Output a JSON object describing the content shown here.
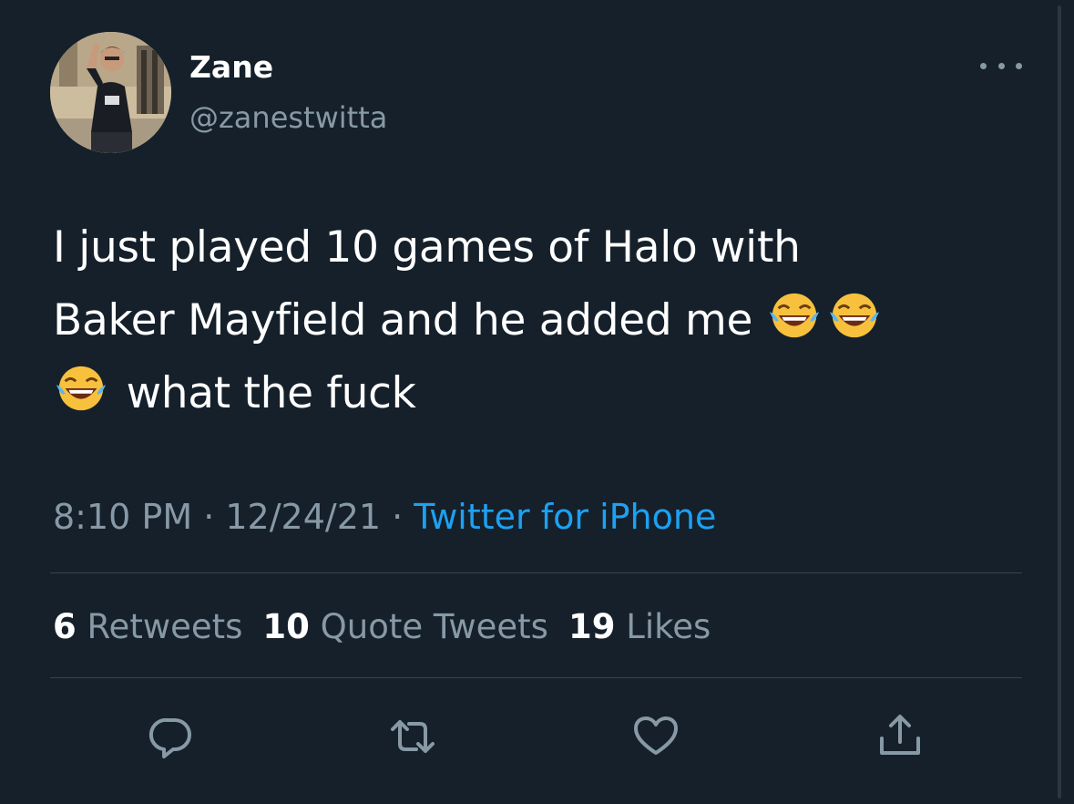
{
  "user": {
    "display_name": "Zane",
    "handle": "@zanestwitta"
  },
  "tweet": {
    "line1": "I just played 10 games of Halo with",
    "line2": "Baker Mayfield and he added me",
    "line3": "what the fuck",
    "emoji_name": "face-with-tears-of-joy"
  },
  "meta": {
    "time": "8:10 PM",
    "sep1": " · ",
    "date": "12/24/21",
    "sep2": " · ",
    "source": "Twitter for iPhone"
  },
  "stats": {
    "retweets_count": "6",
    "retweets_label": "Retweets",
    "quotes_count": "10",
    "quotes_label": "Quote Tweets",
    "likes_count": "19",
    "likes_label": "Likes"
  },
  "icons": {
    "reply": "reply-icon",
    "retweet": "retweet-icon",
    "like": "heart-icon",
    "share": "share-icon",
    "more": "more-icon"
  },
  "colors": {
    "background": "#15202b",
    "secondary_text": "#8899a6",
    "link": "#1da1f2",
    "divider": "#38444d"
  }
}
